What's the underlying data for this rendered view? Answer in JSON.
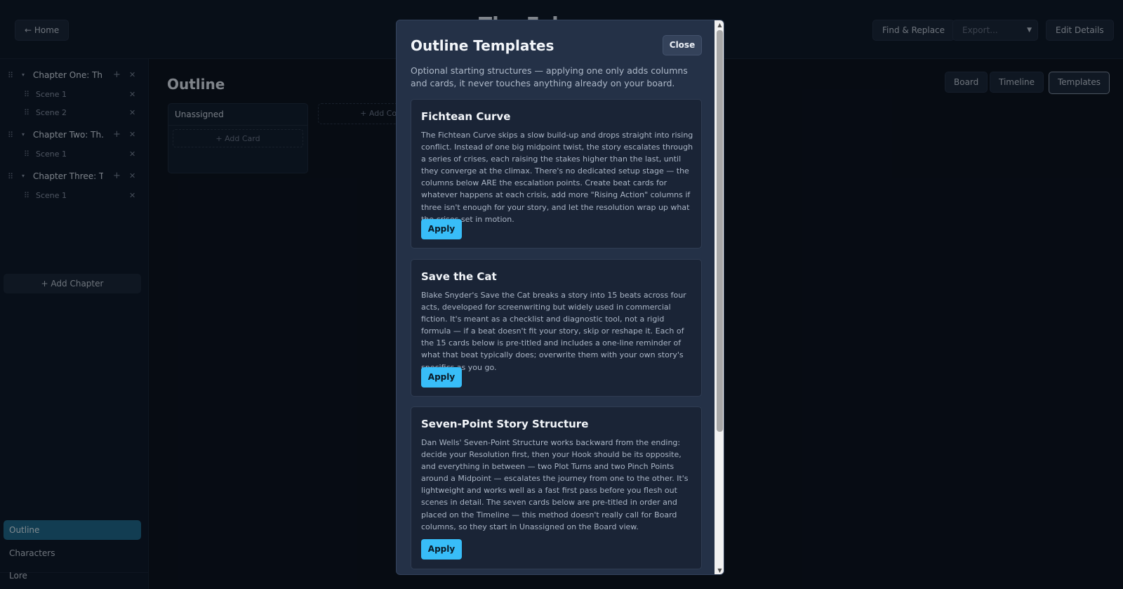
{
  "header": {
    "home_label": "← Home",
    "doc_title": "The Fabr...",
    "find_replace_label": "Find & Replace",
    "export_placeholder": "Export...",
    "edit_details_label": "Edit Details"
  },
  "sidebar": {
    "chapters": [
      {
        "title": "Chapter One: Th...",
        "scenes": [
          "Scene 1",
          "Scene 2"
        ]
      },
      {
        "title": "Chapter Two: Th...",
        "scenes": [
          "Scene 1"
        ]
      },
      {
        "title": "Chapter Three: T...",
        "scenes": [
          "Scene 1"
        ]
      }
    ],
    "add_chapter_label": "+ Add Chapter",
    "nav": [
      "Outline",
      "Characters",
      "Lore"
    ],
    "active_nav": "Outline"
  },
  "main": {
    "title": "Outline",
    "column_title": "Unassigned",
    "add_card_label": "+ Add Card",
    "add_column_label": "+ Add Column",
    "views": [
      "Board",
      "Timeline",
      "Templates"
    ],
    "active_view": "Templates"
  },
  "modal": {
    "title": "Outline Templates",
    "close_label": "Close",
    "description": "Optional starting structures — applying one only adds columns and cards, it never touches anything already on your board.",
    "apply_label": "Apply",
    "templates": [
      {
        "name": "Fichtean Curve",
        "description": "The Fichtean Curve skips a slow build-up and drops straight into rising conflict. Instead of one big midpoint twist, the story escalates through a series of crises, each raising the stakes higher than the last, until they converge at the climax. There's no dedicated setup stage — the columns below ARE the escalation points. Create beat cards for whatever happens at each crisis, add more \"Rising Action\" columns if three isn't enough for your story, and let the resolution wrap up what the crises set in motion."
      },
      {
        "name": "Save the Cat",
        "description": "Blake Snyder's Save the Cat breaks a story into 15 beats across four acts, developed for screenwriting but widely used in commercial fiction. It's meant as a checklist and diagnostic tool, not a rigid formula — if a beat doesn't fit your story, skip or reshape it. Each of the 15 cards below is pre-titled and includes a one-line reminder of what that beat typically does; overwrite them with your own story's specifics as you go."
      },
      {
        "name": "Seven-Point Story Structure",
        "description": "Dan Wells' Seven-Point Structure works backward from the ending: decide your Resolution first, then your Hook should be its opposite, and everything in between — two Plot Turns and two Pinch Points around a Midpoint — escalates the journey from one to the other. It's lightweight and works well as a fast first pass before you flesh out scenes in detail. The seven cards below are pre-titled in order and placed on the Timeline — this method doesn't really call for Board columns, so they start in Unassigned on the Board view."
      }
    ]
  },
  "icons": {
    "grip": "drag-grip-icon",
    "caret": "caret-down-icon",
    "plus": "plus-icon",
    "close": "close-icon",
    "chevron_down": "chevron-down-icon"
  },
  "colors": {
    "accent": "#38bdf8",
    "active_nav": "#1f6a8c",
    "modal_bg": "#243147",
    "page_bg": "#0b111b"
  }
}
